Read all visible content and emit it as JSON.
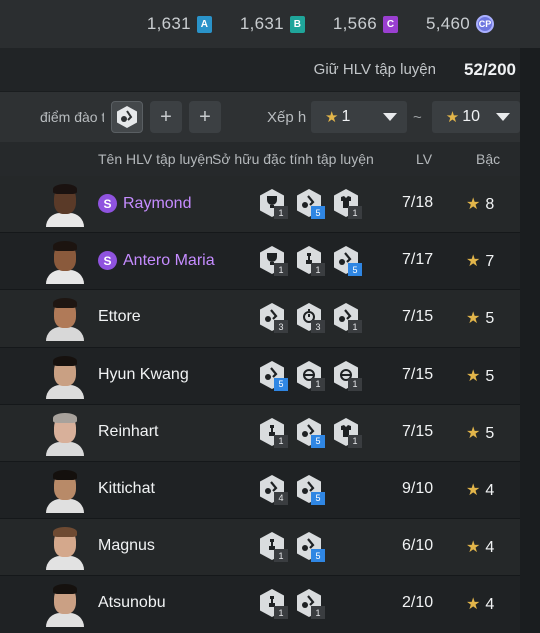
{
  "currencies": [
    {
      "value": "1,631",
      "badge": "A",
      "color": "#2a93c9"
    },
    {
      "value": "1,631",
      "badge": "B",
      "color": "#1fa59a"
    },
    {
      "value": "1,566",
      "badge": "C",
      "color": "#9a3fd1"
    },
    {
      "value": "5,460",
      "badge": "CP",
      "color": "#6f77e0"
    }
  ],
  "quota": {
    "label": "Giữ HLV tập luyện",
    "value": "52/200"
  },
  "filter": {
    "points_label": "điểm đào tạ",
    "rank_label": "Xếp hạ",
    "min": "1",
    "max": "10",
    "separator": "~"
  },
  "columns": {
    "name": "Tên HLV tập luyện",
    "traits": "Sở hữu đặc tính tập luyện",
    "lv": "LV",
    "rank": "Bậc"
  },
  "coaches": [
    {
      "name": "Raymond",
      "special": true,
      "badge": "S",
      "lv": "7/18",
      "rank": "8",
      "skin": "#5a3a28",
      "hair": "#1a1210",
      "shirt": "#e8e8e8",
      "traits": [
        {
          "icon": "trophy-trait-icon",
          "n": "1",
          "boosted": false
        },
        {
          "icon": "kick-trait-icon",
          "n": "5",
          "boosted": true
        },
        {
          "icon": "shirt-trait-icon",
          "n": "1",
          "boosted": false
        }
      ]
    },
    {
      "name": "Antero Maria",
      "special": true,
      "badge": "S",
      "lv": "7/17",
      "rank": "7",
      "skin": "#8a5a3c",
      "hair": "#1c1410",
      "shirt": "#e6e6e6",
      "traits": [
        {
          "icon": "trophy-trait-icon",
          "n": "1",
          "boosted": false
        },
        {
          "icon": "chess-trait-icon",
          "n": "1",
          "boosted": false
        },
        {
          "icon": "kick-trait-icon",
          "n": "5",
          "boosted": true
        }
      ]
    },
    {
      "name": "Ettore",
      "special": false,
      "badge": "",
      "lv": "7/15",
      "rank": "5",
      "skin": "#b07a58",
      "hair": "#1e1612",
      "shirt": "#d8d8d8",
      "traits": [
        {
          "icon": "kick-trait-icon",
          "n": "3",
          "boosted": false
        },
        {
          "icon": "stopwatch-trait-icon",
          "n": "3",
          "boosted": false
        },
        {
          "icon": "kick-trait-icon",
          "n": "1",
          "boosted": false
        }
      ]
    },
    {
      "name": "Hyun Kwang",
      "special": false,
      "badge": "",
      "lv": "7/15",
      "rank": "5",
      "skin": "#c9a083",
      "hair": "#16110e",
      "shirt": "#dcdcdc",
      "traits": [
        {
          "icon": "kick-trait-icon",
          "n": "5",
          "boosted": true
        },
        {
          "icon": "ball-trait-icon",
          "n": "1",
          "boosted": false
        },
        {
          "icon": "ball-trait-icon",
          "n": "1",
          "boosted": false
        }
      ]
    },
    {
      "name": "Reinhart",
      "special": false,
      "badge": "",
      "lv": "7/15",
      "rank": "5",
      "skin": "#d8b09a",
      "hair": "#a8a29c",
      "shirt": "#dadada",
      "traits": [
        {
          "icon": "chess-trait-icon",
          "n": "1",
          "boosted": false
        },
        {
          "icon": "kick-trait-icon",
          "n": "5",
          "boosted": true
        },
        {
          "icon": "shirt-trait-icon",
          "n": "1",
          "boosted": false
        }
      ]
    },
    {
      "name": "Kittichat",
      "special": false,
      "badge": "",
      "lv": "9/10",
      "rank": "4",
      "skin": "#b88a68",
      "hair": "#14100d",
      "shirt": "#e0e0e0",
      "traits": [
        {
          "icon": "kick-trait-icon",
          "n": "4",
          "boosted": false
        },
        {
          "icon": "kick-trait-icon",
          "n": "5",
          "boosted": true
        }
      ]
    },
    {
      "name": "Magnus",
      "special": false,
      "badge": "",
      "lv": "6/10",
      "rank": "4",
      "skin": "#d4a88c",
      "hair": "#6e4a32",
      "shirt": "#e2e2e2",
      "traits": [
        {
          "icon": "chess-trait-icon",
          "n": "1",
          "boosted": false
        },
        {
          "icon": "kick-trait-icon",
          "n": "5",
          "boosted": true
        }
      ]
    },
    {
      "name": "Atsunobu",
      "special": false,
      "badge": "",
      "lv": "2/10",
      "rank": "4",
      "skin": "#caa084",
      "hair": "#15110e",
      "shirt": "#e0e0e0",
      "traits": [
        {
          "icon": "chess-trait-icon",
          "n": "1",
          "boosted": false
        },
        {
          "icon": "kick-trait-icon",
          "n": "1",
          "boosted": false
        }
      ]
    }
  ]
}
